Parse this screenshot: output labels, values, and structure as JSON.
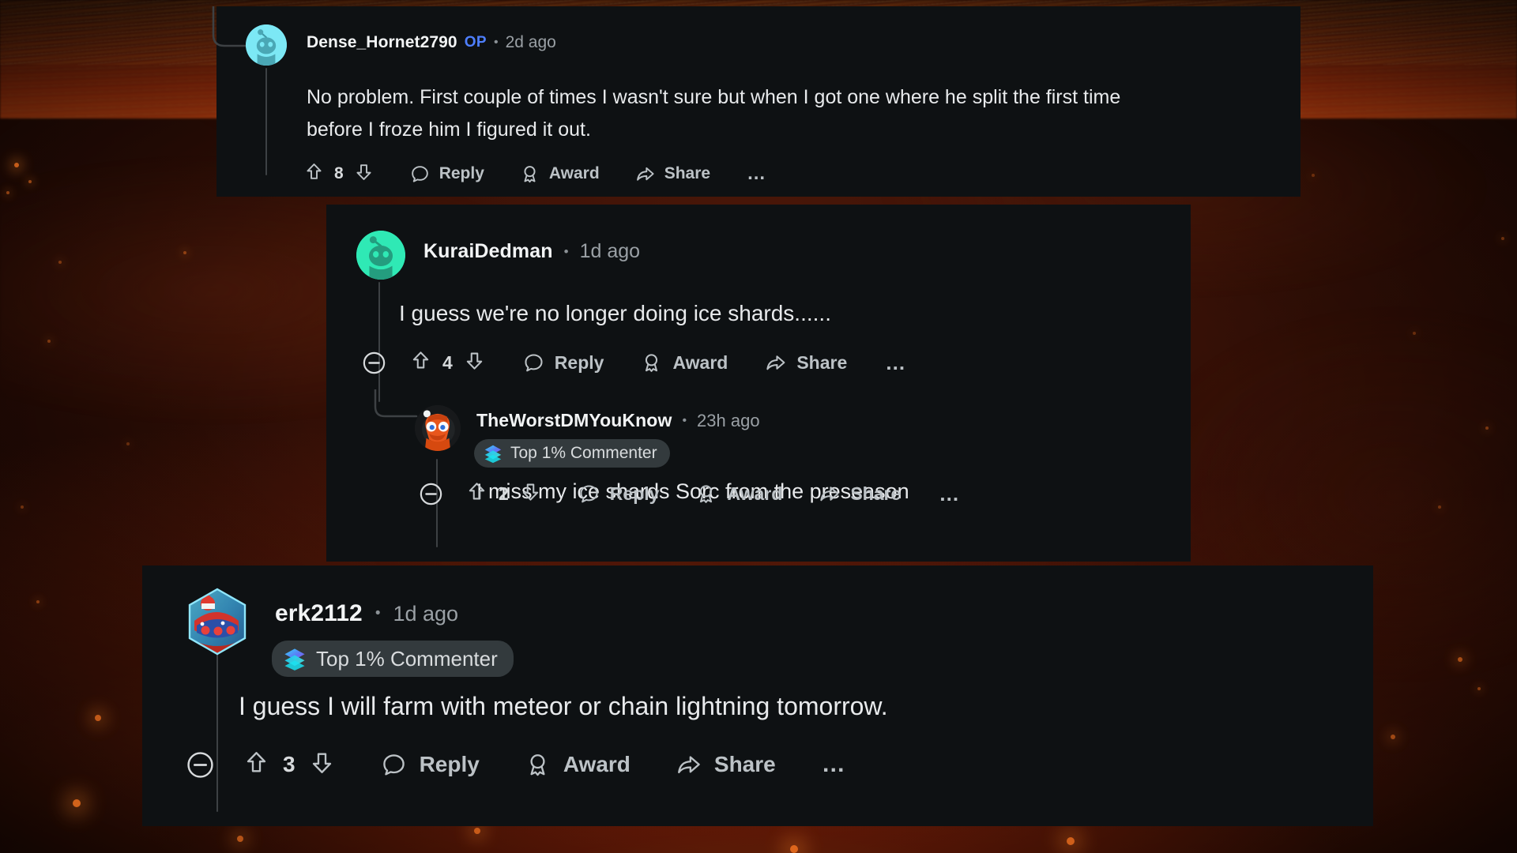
{
  "app": {
    "name": "Reddit",
    "view": "comment-thread",
    "background_description": "fiery dark red lava environment",
    "colors": {
      "card_bg": "#0e1113",
      "text_primary": "#e8eaec",
      "text_secondary": "#9aa0a5",
      "op_blue": "#4e7fff",
      "badge_bg": "#333a3d",
      "thread_line": "#3d4144",
      "bg_ember": "#ff7a22"
    }
  },
  "comments": [
    {
      "id": "c1",
      "username": "Dense_Hornet2790",
      "op_label": "OP",
      "separator": "•",
      "timestamp": "2d ago",
      "avatar": "snoo-avatar-cyan",
      "badge": null,
      "body_lines": [
        "No problem. First couple of times I wasn't sure but when I got one where he split the first time",
        "before I froze him I figured it out."
      ],
      "score": "8",
      "has_collapse": false,
      "actions": [
        {
          "name": "upvote",
          "icon": "upvote-arrow-icon",
          "label": ""
        },
        {
          "name": "score",
          "icon": "",
          "label": "8"
        },
        {
          "name": "downvote",
          "icon": "downvote-arrow-icon",
          "label": ""
        },
        {
          "name": "reply",
          "icon": "comment-bubble-icon",
          "label": "Reply"
        },
        {
          "name": "award",
          "icon": "award-rosette-icon",
          "label": "Award"
        },
        {
          "name": "share",
          "icon": "share-arrow-icon",
          "label": "Share"
        },
        {
          "name": "more",
          "icon": "ellipsis-icon",
          "label": "…"
        }
      ]
    },
    {
      "id": "c2",
      "username": "KuraiDedman",
      "op_label": null,
      "separator": "•",
      "timestamp": "1d ago",
      "avatar": "snoo-avatar-green",
      "badge": null,
      "body_lines": [
        "I guess we're no longer doing ice shards......"
      ],
      "score": "4",
      "has_collapse": true,
      "actions": [
        {
          "name": "collapse",
          "icon": "minus-circle-icon",
          "label": ""
        },
        {
          "name": "upvote",
          "icon": "upvote-arrow-icon",
          "label": ""
        },
        {
          "name": "score",
          "icon": "",
          "label": "4"
        },
        {
          "name": "downvote",
          "icon": "downvote-arrow-icon",
          "label": ""
        },
        {
          "name": "reply",
          "icon": "comment-bubble-icon",
          "label": "Reply"
        },
        {
          "name": "award",
          "icon": "award-rosette-icon",
          "label": "Award"
        },
        {
          "name": "share",
          "icon": "share-arrow-icon",
          "label": "Share"
        },
        {
          "name": "more",
          "icon": "ellipsis-icon",
          "label": "…"
        }
      ]
    },
    {
      "id": "c3",
      "username": "TheWorstDMYouKnow",
      "op_label": null,
      "separator": "•",
      "timestamp": "23h ago",
      "avatar": "avatar-orange-beard",
      "badge": {
        "label": "Top 1% Commenter",
        "icon": "top-commenter-icon"
      },
      "body_lines": [
        "I miss my ice shards Sorc from the preseason"
      ],
      "score": "2",
      "has_collapse": true,
      "actions": [
        {
          "name": "collapse",
          "icon": "minus-circle-icon",
          "label": ""
        },
        {
          "name": "upvote",
          "icon": "upvote-arrow-icon",
          "label": ""
        },
        {
          "name": "score",
          "icon": "",
          "label": "2"
        },
        {
          "name": "downvote",
          "icon": "downvote-arrow-icon",
          "label": ""
        },
        {
          "name": "reply",
          "icon": "comment-bubble-icon",
          "label": "Reply"
        },
        {
          "name": "award",
          "icon": "award-rosette-icon",
          "label": "Award"
        },
        {
          "name": "share",
          "icon": "share-arrow-icon",
          "label": "Share"
        },
        {
          "name": "more",
          "icon": "ellipsis-icon",
          "label": "…"
        }
      ]
    },
    {
      "id": "c4",
      "username": "erk2112",
      "op_label": null,
      "separator": "•",
      "timestamp": "1d ago",
      "avatar": "avatar-hex-patriot",
      "badge": {
        "label": "Top 1% Commenter",
        "icon": "top-commenter-icon"
      },
      "body_lines": [
        "I guess I will farm with meteor or chain lightning tomorrow."
      ],
      "score": "3",
      "has_collapse": true,
      "actions": [
        {
          "name": "collapse",
          "icon": "minus-circle-icon",
          "label": ""
        },
        {
          "name": "upvote",
          "icon": "upvote-arrow-icon",
          "label": ""
        },
        {
          "name": "score",
          "icon": "",
          "label": "3"
        },
        {
          "name": "downvote",
          "icon": "downvote-arrow-icon",
          "label": ""
        },
        {
          "name": "reply",
          "icon": "comment-bubble-icon",
          "label": "Reply"
        },
        {
          "name": "award",
          "icon": "award-rosette-icon",
          "label": "Award"
        },
        {
          "name": "share",
          "icon": "share-arrow-icon",
          "label": "Share"
        },
        {
          "name": "more",
          "icon": "ellipsis-icon",
          "label": "…"
        }
      ]
    }
  ]
}
